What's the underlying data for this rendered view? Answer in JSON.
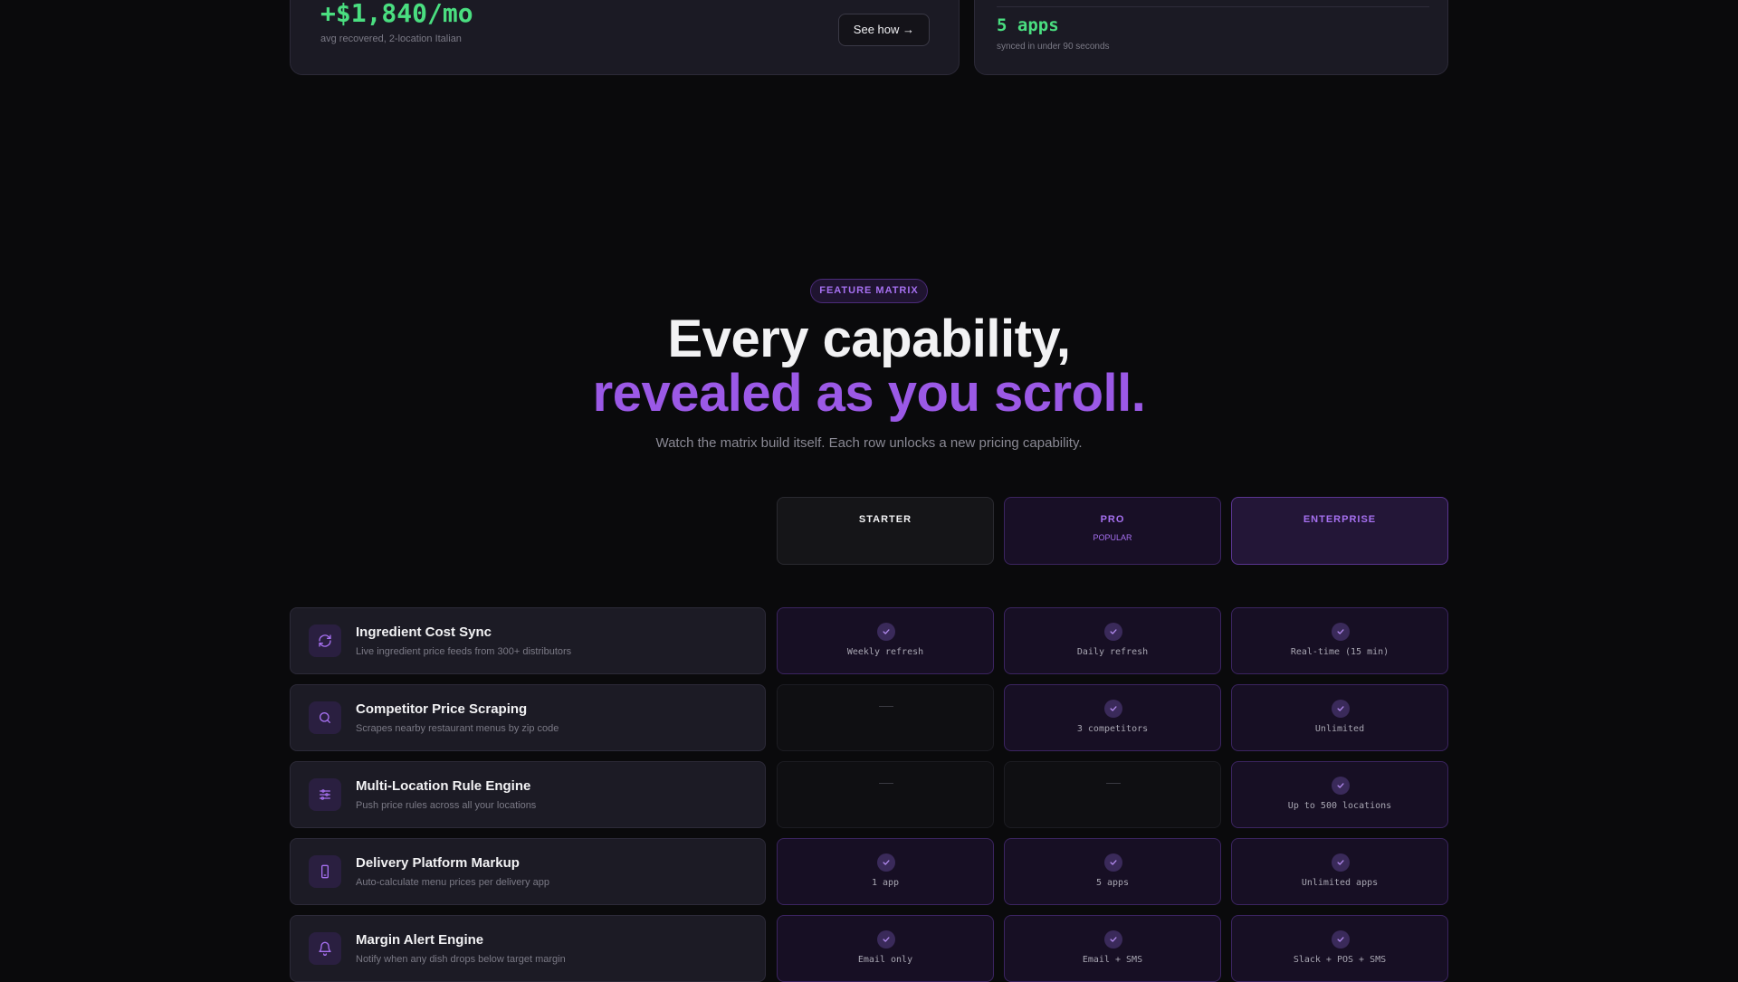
{
  "stats": {
    "left": {
      "value": "+$1,840/mo",
      "caption": "avg recovered, 2-location Italian",
      "button_label": "See how →"
    },
    "right": {
      "value": "5 apps",
      "caption": "synced in under 90 seconds"
    }
  },
  "section": {
    "badge": "FEATURE MATRIX",
    "title_line1": "Every capability,",
    "title_line2": "revealed as you scroll.",
    "subtitle": "Watch the matrix build itself. Each row unlocks a new pricing capability."
  },
  "tiers": {
    "starter": {
      "name": "STARTER"
    },
    "pro": {
      "name": "PRO",
      "tag": "POPULAR"
    },
    "enterprise": {
      "name": "ENTERPRISE"
    }
  },
  "colors": {
    "accent": "#9b59e6",
    "positive": "#4ade80",
    "background": "#0a0a0c"
  },
  "features": [
    {
      "icon": "refresh-icon",
      "name": "Ingredient Cost Sync",
      "desc": "Live ingredient price feeds from 300+ distributors",
      "starter": "Weekly refresh",
      "pro": "Daily refresh",
      "enterprise": "Real-time (15 min)"
    },
    {
      "icon": "search-icon",
      "name": "Competitor Price Scraping",
      "desc": "Scrapes nearby restaurant menus by zip code",
      "starter": null,
      "pro": "3 competitors",
      "enterprise": "Unlimited"
    },
    {
      "icon": "sliders-icon",
      "name": "Multi-Location Rule Engine",
      "desc": "Push price rules across all your locations",
      "starter": null,
      "pro": null,
      "enterprise": "Up to 500 locations"
    },
    {
      "icon": "phone-icon",
      "name": "Delivery Platform Markup",
      "desc": "Auto-calculate menu prices per delivery app",
      "starter": "1 app",
      "pro": "5 apps",
      "enterprise": "Unlimited apps"
    },
    {
      "icon": "bell-icon",
      "name": "Margin Alert Engine",
      "desc": "Notify when any dish drops below target margin",
      "starter": "Email only",
      "pro": "Email + SMS",
      "enterprise": "Slack + POS + SMS"
    }
  ]
}
